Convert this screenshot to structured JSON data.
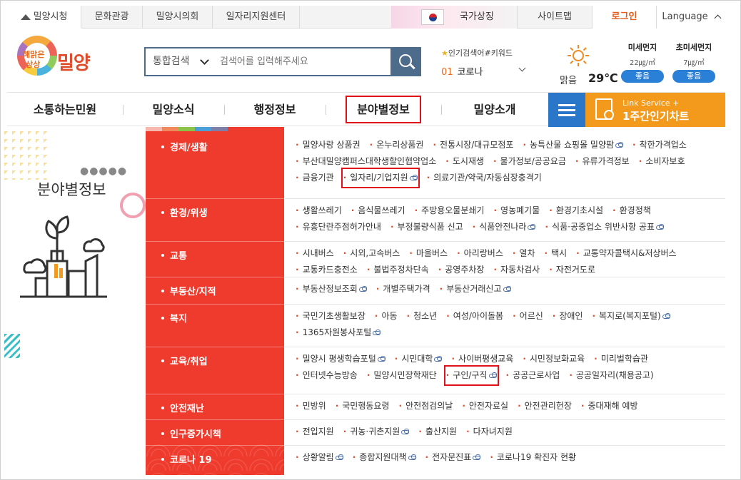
{
  "utilbar": {
    "tabs": [
      "밀양시청",
      "문화관광",
      "밀양시의회",
      "일자리지원센터"
    ],
    "flag_label": "국가상징",
    "sitemap": "사이트맵",
    "login": "로그인",
    "language": "Language"
  },
  "logo": {
    "tag1": "해맑은",
    "tag2": "상상",
    "name": "밀양"
  },
  "search": {
    "scope": "통합검색",
    "placeholder": "검색어를 입력해주세요"
  },
  "popular": {
    "title": "인기검색어#키워드",
    "rank": "01",
    "keyword": "코로나"
  },
  "weather": {
    "condition": "맑음",
    "temp": "29℃"
  },
  "dust": [
    {
      "label": "미세먼지",
      "value": "22㎍/㎥",
      "status": "좋음"
    },
    {
      "label": "초미세먼지",
      "value": "7㎍/㎥",
      "status": "좋음"
    }
  ],
  "gnb": {
    "items": [
      "소통하는민원",
      "밀양소식",
      "행정정보",
      "분야별정보",
      "밀양소개"
    ],
    "link_service_small": "Link Service +",
    "link_service_big": "1주간인기차트"
  },
  "side": {
    "title": "분야별정보"
  },
  "colors": {
    "accent_red": "#ee3b2d",
    "highlight": "#e0101a",
    "nav_blue": "#2a76c9",
    "orange": "#f39a1d"
  },
  "categories": [
    {
      "name": "경제/생활",
      "links": [
        {
          "t": "밀양사랑 상품권"
        },
        {
          "t": "온누리상품권"
        },
        {
          "t": "전통시장/대규모점포"
        },
        {
          "t": "농특산물 쇼핑몰 밀양팜",
          "ext": true
        },
        {
          "t": "착한가격업소"
        },
        {
          "t": "부산대밀양캠퍼스대학생할인협약업소"
        },
        {
          "t": "도시재생"
        },
        {
          "t": "물가정보/공공요금"
        },
        {
          "t": "유류가격정보"
        },
        {
          "t": "소비자보호"
        },
        {
          "t": "금융기관"
        },
        {
          "t": "일자리/기업지원",
          "ext": true,
          "hl": true
        },
        {
          "t": "의료기관/약국/자동심장충격기"
        }
      ]
    },
    {
      "name": "환경/위생",
      "links": [
        {
          "t": "생활쓰레기"
        },
        {
          "t": "음식물쓰레기"
        },
        {
          "t": "주방용오물분쇄기"
        },
        {
          "t": "영농폐기물"
        },
        {
          "t": "환경기초시설"
        },
        {
          "t": "환경정책"
        },
        {
          "t": "유흥단란주점허가안내"
        },
        {
          "t": "부정불량식품 신고"
        },
        {
          "t": "식품안전나라",
          "ext": true
        },
        {
          "t": "식품·공중업소 위반사항 공표",
          "ext": true
        }
      ]
    },
    {
      "name": "교통",
      "links": [
        {
          "t": "시내버스"
        },
        {
          "t": "시외,고속버스"
        },
        {
          "t": "마을버스"
        },
        {
          "t": "아리랑버스"
        },
        {
          "t": "열차"
        },
        {
          "t": "택시"
        },
        {
          "t": "교통약자콜택시&저상버스"
        },
        {
          "t": "교통카드충전소"
        },
        {
          "t": "불법주정차단속"
        },
        {
          "t": "공영주차장"
        },
        {
          "t": "자동차검사"
        },
        {
          "t": "자전거도로"
        }
      ]
    },
    {
      "name": "부동산/지적",
      "links": [
        {
          "t": "부동산정보조회",
          "ext": true
        },
        {
          "t": "개별주택가격"
        },
        {
          "t": "부동산거래신고",
          "ext": true
        }
      ]
    },
    {
      "name": "복지",
      "links": [
        {
          "t": "국민기초생활보장"
        },
        {
          "t": "아동"
        },
        {
          "t": "청소년"
        },
        {
          "t": "여성/아이돌봄"
        },
        {
          "t": "어르신"
        },
        {
          "t": "장애인"
        },
        {
          "t": "복지로(복지포털)",
          "ext": true
        },
        {
          "t": "1365자원봉사포털",
          "ext": true
        }
      ]
    },
    {
      "name": "교육/취업",
      "links": [
        {
          "t": "밀양시 평생학습포털",
          "ext": true
        },
        {
          "t": "시민대학",
          "ext": true
        },
        {
          "t": "사이버평생교육"
        },
        {
          "t": "시민정보화교육"
        },
        {
          "t": "미리벌학습관"
        },
        {
          "t": "인터넷수능방송"
        },
        {
          "t": "밀양시민장학재단"
        },
        {
          "t": "구인/구직",
          "ext": true,
          "hl": true
        },
        {
          "t": "공공근로사업"
        },
        {
          "t": "공공일자리(채용공고)"
        }
      ]
    },
    {
      "name": "안전재난",
      "links": [
        {
          "t": "민방위"
        },
        {
          "t": "국민행동요령"
        },
        {
          "t": "안전점검의날"
        },
        {
          "t": "안전자료실"
        },
        {
          "t": "안전관리헌장"
        },
        {
          "t": "중대재해 예방"
        }
      ]
    },
    {
      "name": "인구증가시책",
      "links": [
        {
          "t": "전입지원"
        },
        {
          "t": "귀농·귀촌지원",
          "ext": true
        },
        {
          "t": "출산지원"
        },
        {
          "t": "다자녀지원"
        }
      ]
    },
    {
      "name": "코로나 19",
      "links": [
        {
          "t": "상황알림",
          "ext": true
        },
        {
          "t": "종합지원대책",
          "ext": true
        },
        {
          "t": "전자문진표",
          "ext": true
        },
        {
          "t": "코로나19 확진자 현황"
        }
      ]
    }
  ]
}
